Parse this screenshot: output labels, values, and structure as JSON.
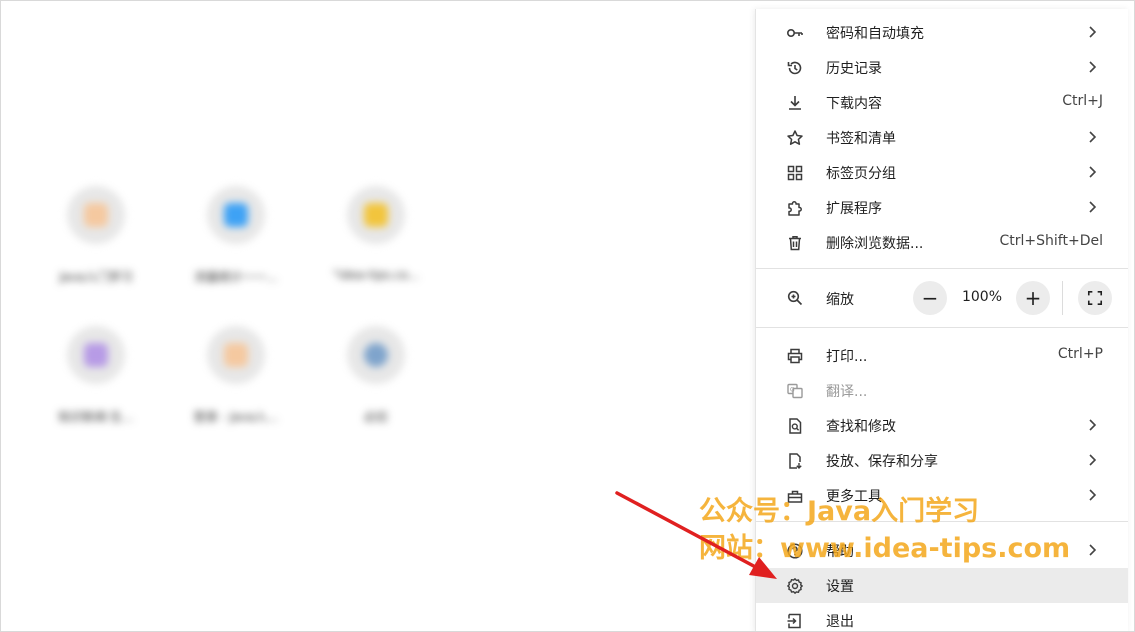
{
  "shortcuts": [
    {
      "label": "Java入门学习",
      "color": "#f5c9a0"
    },
    {
      "label": "流量统计一一...",
      "color": "#3ea2f5"
    },
    {
      "label": "\"idea-tips.co...",
      "color": "#f2c53d"
    },
    {
      "label": "知识新闻·生...",
      "color": "#b79be6"
    },
    {
      "label": "登录 - Java入...",
      "color": "#f5c9a0"
    },
    {
      "label": "必应",
      "color": "#7fa4cc"
    }
  ],
  "menu": {
    "passwords": {
      "label": "密码和自动填充",
      "icon": "key-icon"
    },
    "history": {
      "label": "历史记录",
      "icon": "history-icon"
    },
    "downloads": {
      "label": "下载内容",
      "shortcut": "Ctrl+J",
      "icon": "download-icon"
    },
    "bookmarks": {
      "label": "书签和清单",
      "icon": "star-icon"
    },
    "tab_groups": {
      "label": "标签页分组",
      "icon": "grid-icon"
    },
    "extensions": {
      "label": "扩展程序",
      "icon": "puzzle-icon"
    },
    "clear_data": {
      "label": "删除浏览数据...",
      "shortcut": "Ctrl+Shift+Del",
      "icon": "trash-icon"
    },
    "zoom": {
      "label": "缩放",
      "value": "100%",
      "minus": "−",
      "plus": "+",
      "icon": "zoom-icon"
    },
    "print": {
      "label": "打印...",
      "shortcut": "Ctrl+P",
      "icon": "print-icon"
    },
    "translate": {
      "label": "翻译...",
      "icon": "translate-icon"
    },
    "find": {
      "label": "查找和修改",
      "icon": "find-icon"
    },
    "cast": {
      "label": "投放、保存和分享",
      "icon": "cast-icon"
    },
    "more_tools": {
      "label": "更多工具",
      "icon": "toolbox-icon"
    },
    "help": {
      "label": "帮助",
      "icon": "help-icon"
    },
    "settings": {
      "label": "设置",
      "icon": "gear-icon"
    },
    "exit": {
      "label": "退出",
      "icon": "exit-icon"
    }
  },
  "watermark": {
    "line1": "公众号：Java入门学习",
    "line2": "网站：www.idea-tips.com"
  },
  "colors": {
    "watermark": "#f4a81c",
    "arrow": "#e02020",
    "selected_bg": "#ebebeb"
  }
}
